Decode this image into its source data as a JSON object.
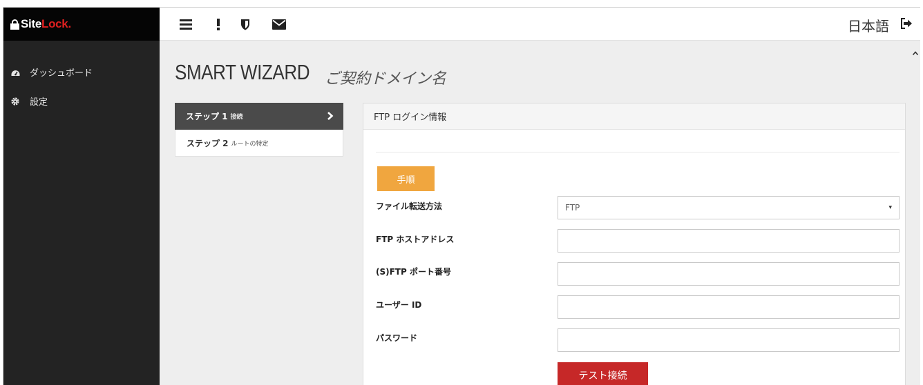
{
  "brand": {
    "logo_site": "Site",
    "logo_lock": "Lock."
  },
  "sidebar": {
    "items": [
      {
        "label": "ダッシュボード",
        "icon": "dashboard-icon"
      },
      {
        "label": "設定",
        "icon": "gear-icon"
      }
    ]
  },
  "topbar": {
    "icons": [
      "menu-icon",
      "alert-icon",
      "shield-icon",
      "envelope-icon"
    ],
    "language": "日本語",
    "logout_icon": "logout-icon"
  },
  "page": {
    "title": "SMART WIZARD",
    "subtitle": "ご契約ドメイン名"
  },
  "steps": [
    {
      "label": "ステップ 1",
      "sub": "接続",
      "active": true
    },
    {
      "label": "ステップ 2",
      "sub": "ルートの特定",
      "active": false
    }
  ],
  "panel": {
    "heading": "FTP ログイン情報",
    "instructions_button": "手順",
    "fields": {
      "transfer_method": {
        "label": "ファイル転送方法",
        "value": "FTP"
      },
      "host": {
        "label": "FTP ホストアドレス",
        "value": ""
      },
      "port": {
        "label": "(S)FTP ポート番号",
        "value": ""
      },
      "user": {
        "label": "ユーザー ID",
        "value": ""
      },
      "password": {
        "label": "パスワード",
        "value": ""
      }
    },
    "test_button": "テスト接続"
  },
  "colors": {
    "sidebar_bg": "#232323",
    "logo_bg": "#050505",
    "accent_red": "#c62828",
    "accent_orange": "#f0a63f",
    "active_step_bg": "#4a4a4a"
  }
}
